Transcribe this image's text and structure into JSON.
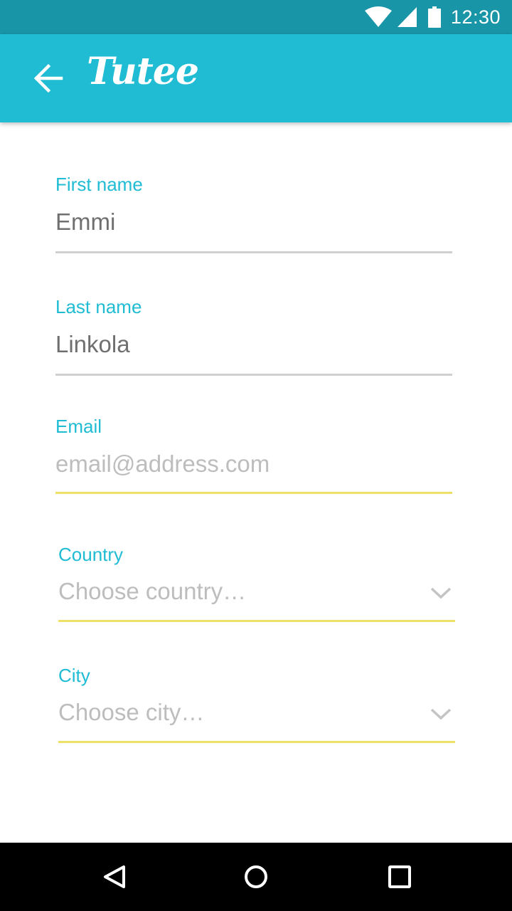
{
  "status_bar": {
    "time": "12:30",
    "icons": [
      "wifi-icon",
      "signal-icon",
      "battery-icon"
    ]
  },
  "app_bar": {
    "back_icon": "arrow-left-icon",
    "logo_text": "Tutee",
    "background_color": "#1fbcd4"
  },
  "form": {
    "first_name": {
      "label": "First name",
      "value": "Emmi"
    },
    "last_name": {
      "label": "Last name",
      "value": "Linkola"
    },
    "email": {
      "label": "Email",
      "value": "",
      "placeholder": "email@address.com"
    },
    "country": {
      "label": "Country",
      "placeholder": "Choose country…",
      "icon": "chevron-down-icon"
    },
    "city": {
      "label": "City",
      "placeholder": "Choose city…",
      "icon": "chevron-down-icon"
    }
  },
  "colors": {
    "accent": "#1fbcd4",
    "status_bar": "#1896a8",
    "active_underline": "#efe068",
    "inactive_underline": "#cfcfcf"
  },
  "nav_bar": {
    "icons": [
      "back-triangle-icon",
      "home-circle-icon",
      "recents-square-icon"
    ]
  }
}
